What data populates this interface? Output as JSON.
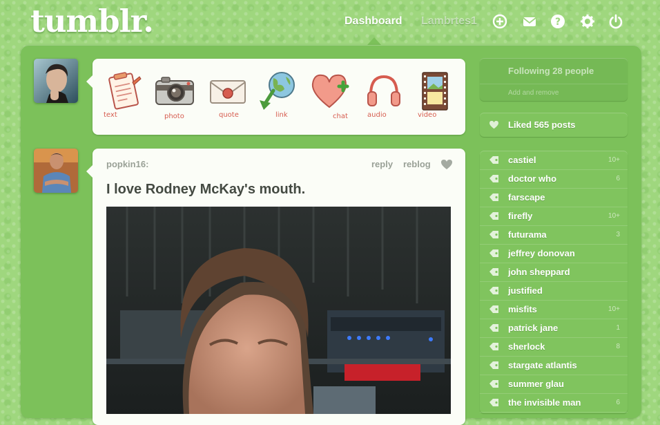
{
  "header": {
    "logo": "tumblr.",
    "nav": [
      {
        "label": "Dashboard",
        "active": true
      },
      {
        "label": "Lambrtes1",
        "active": false
      }
    ],
    "icons": [
      "compose-icon",
      "mail-icon",
      "help-icon",
      "gear-icon",
      "power-icon"
    ]
  },
  "composer": {
    "buttons": [
      {
        "label": "text",
        "icon": "clipboard-icon"
      },
      {
        "label": "photo",
        "icon": "camera-icon"
      },
      {
        "label": "quote",
        "icon": "envelope-icon"
      },
      {
        "label": "link",
        "icon": "globe-arrow-icon"
      },
      {
        "label": "chat",
        "icon": "heart-plus-icon"
      },
      {
        "label": "audio",
        "icon": "headphones-icon"
      },
      {
        "label": "video",
        "icon": "film-icon"
      }
    ]
  },
  "post": {
    "author": "popkin16:",
    "reply_label": "reply",
    "reblog_label": "reblog",
    "title": "I love Rodney McKay's mouth."
  },
  "sidebar": {
    "following": {
      "label": "Following 28 people",
      "sub": "Add and remove"
    },
    "liked": {
      "label": "Liked 565 posts"
    },
    "tags": [
      {
        "name": "castiel",
        "count": "10+"
      },
      {
        "name": "doctor who",
        "count": "6"
      },
      {
        "name": "farscape",
        "count": ""
      },
      {
        "name": "firefly",
        "count": "10+"
      },
      {
        "name": "futurama",
        "count": "3"
      },
      {
        "name": "jeffrey donovan",
        "count": ""
      },
      {
        "name": "john sheppard",
        "count": ""
      },
      {
        "name": "justified",
        "count": ""
      },
      {
        "name": "misfits",
        "count": "10+"
      },
      {
        "name": "patrick jane",
        "count": "1"
      },
      {
        "name": "sherlock",
        "count": "8"
      },
      {
        "name": "stargate atlantis",
        "count": ""
      },
      {
        "name": "summer glau",
        "count": ""
      },
      {
        "name": "the invisible man",
        "count": "6"
      }
    ]
  },
  "colors": {
    "background": "#9fd77e",
    "frame": "#7cc15a",
    "panel": "#fbfdf7",
    "accent_red": "#d65c4f"
  }
}
